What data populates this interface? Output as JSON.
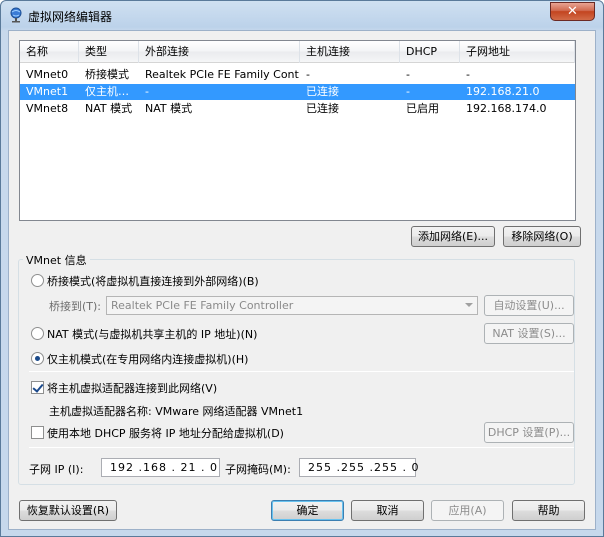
{
  "window": {
    "title": "虚拟网络编辑器",
    "close_glyph": "✕"
  },
  "table": {
    "headers": [
      "名称",
      "类型",
      "外部连接",
      "主机连接",
      "DHCP",
      "子网地址"
    ],
    "rows": [
      [
        "VMnet0",
        "桥接模式",
        "Realtek PCIe FE Family Cont…",
        "-",
        "-",
        "-"
      ],
      [
        "VMnet1",
        "仅主机…",
        "-",
        "已连接",
        "-",
        "192.168.21.0"
      ],
      [
        "VMnet8",
        "NAT 模式",
        "NAT 模式",
        "已连接",
        "已启用",
        "192.168.174.0"
      ]
    ],
    "selected_row": 1
  },
  "buttons": {
    "add_network": "添加网络(E)...",
    "remove_network": "移除网络(O)",
    "auto_settings": "自动设置(U)...",
    "nat_settings": "NAT 设置(S)...",
    "dhcp_settings": "DHCP 设置(P)...",
    "restore_defaults": "恢复默认设置(R)",
    "ok": "确定",
    "cancel": "取消",
    "apply": "应用(A)",
    "help": "帮助"
  },
  "vmnet_info": {
    "group_title": "VMnet 信息",
    "bridged_label": "桥接模式(将虚拟机直接连接到外部网络)(B)",
    "bridged_to_label": "桥接到(T):",
    "bridged_to_value": "Realtek PCIe FE Family Controller",
    "nat_label": "NAT 模式(与虚拟机共享主机的 IP 地址)(N)",
    "host_only_label": "仅主机模式(在专用网络内连接虚拟机)(H)",
    "selected_mode": "host_only",
    "connect_adapter_label": "将主机虚拟适配器连接到此网络(V)",
    "connect_adapter_checked": true,
    "adapter_name_label": "主机虚拟适配器名称: VMware 网络适配器 VMnet1",
    "use_dhcp_label": "使用本地 DHCP 服务将 IP 地址分配给虚拟机(D)",
    "use_dhcp_checked": false,
    "subnet_ip_label": "子网 IP (I):",
    "subnet_ip_value": "192 .168 . 21  . 0",
    "subnet_mask_label": "子网掩码(M):",
    "subnet_mask_value": "255 .255 .255 . 0"
  },
  "colors": {
    "selection": "#3399ff",
    "title_bar": "#bcd2ea",
    "close": "#c3441f"
  }
}
